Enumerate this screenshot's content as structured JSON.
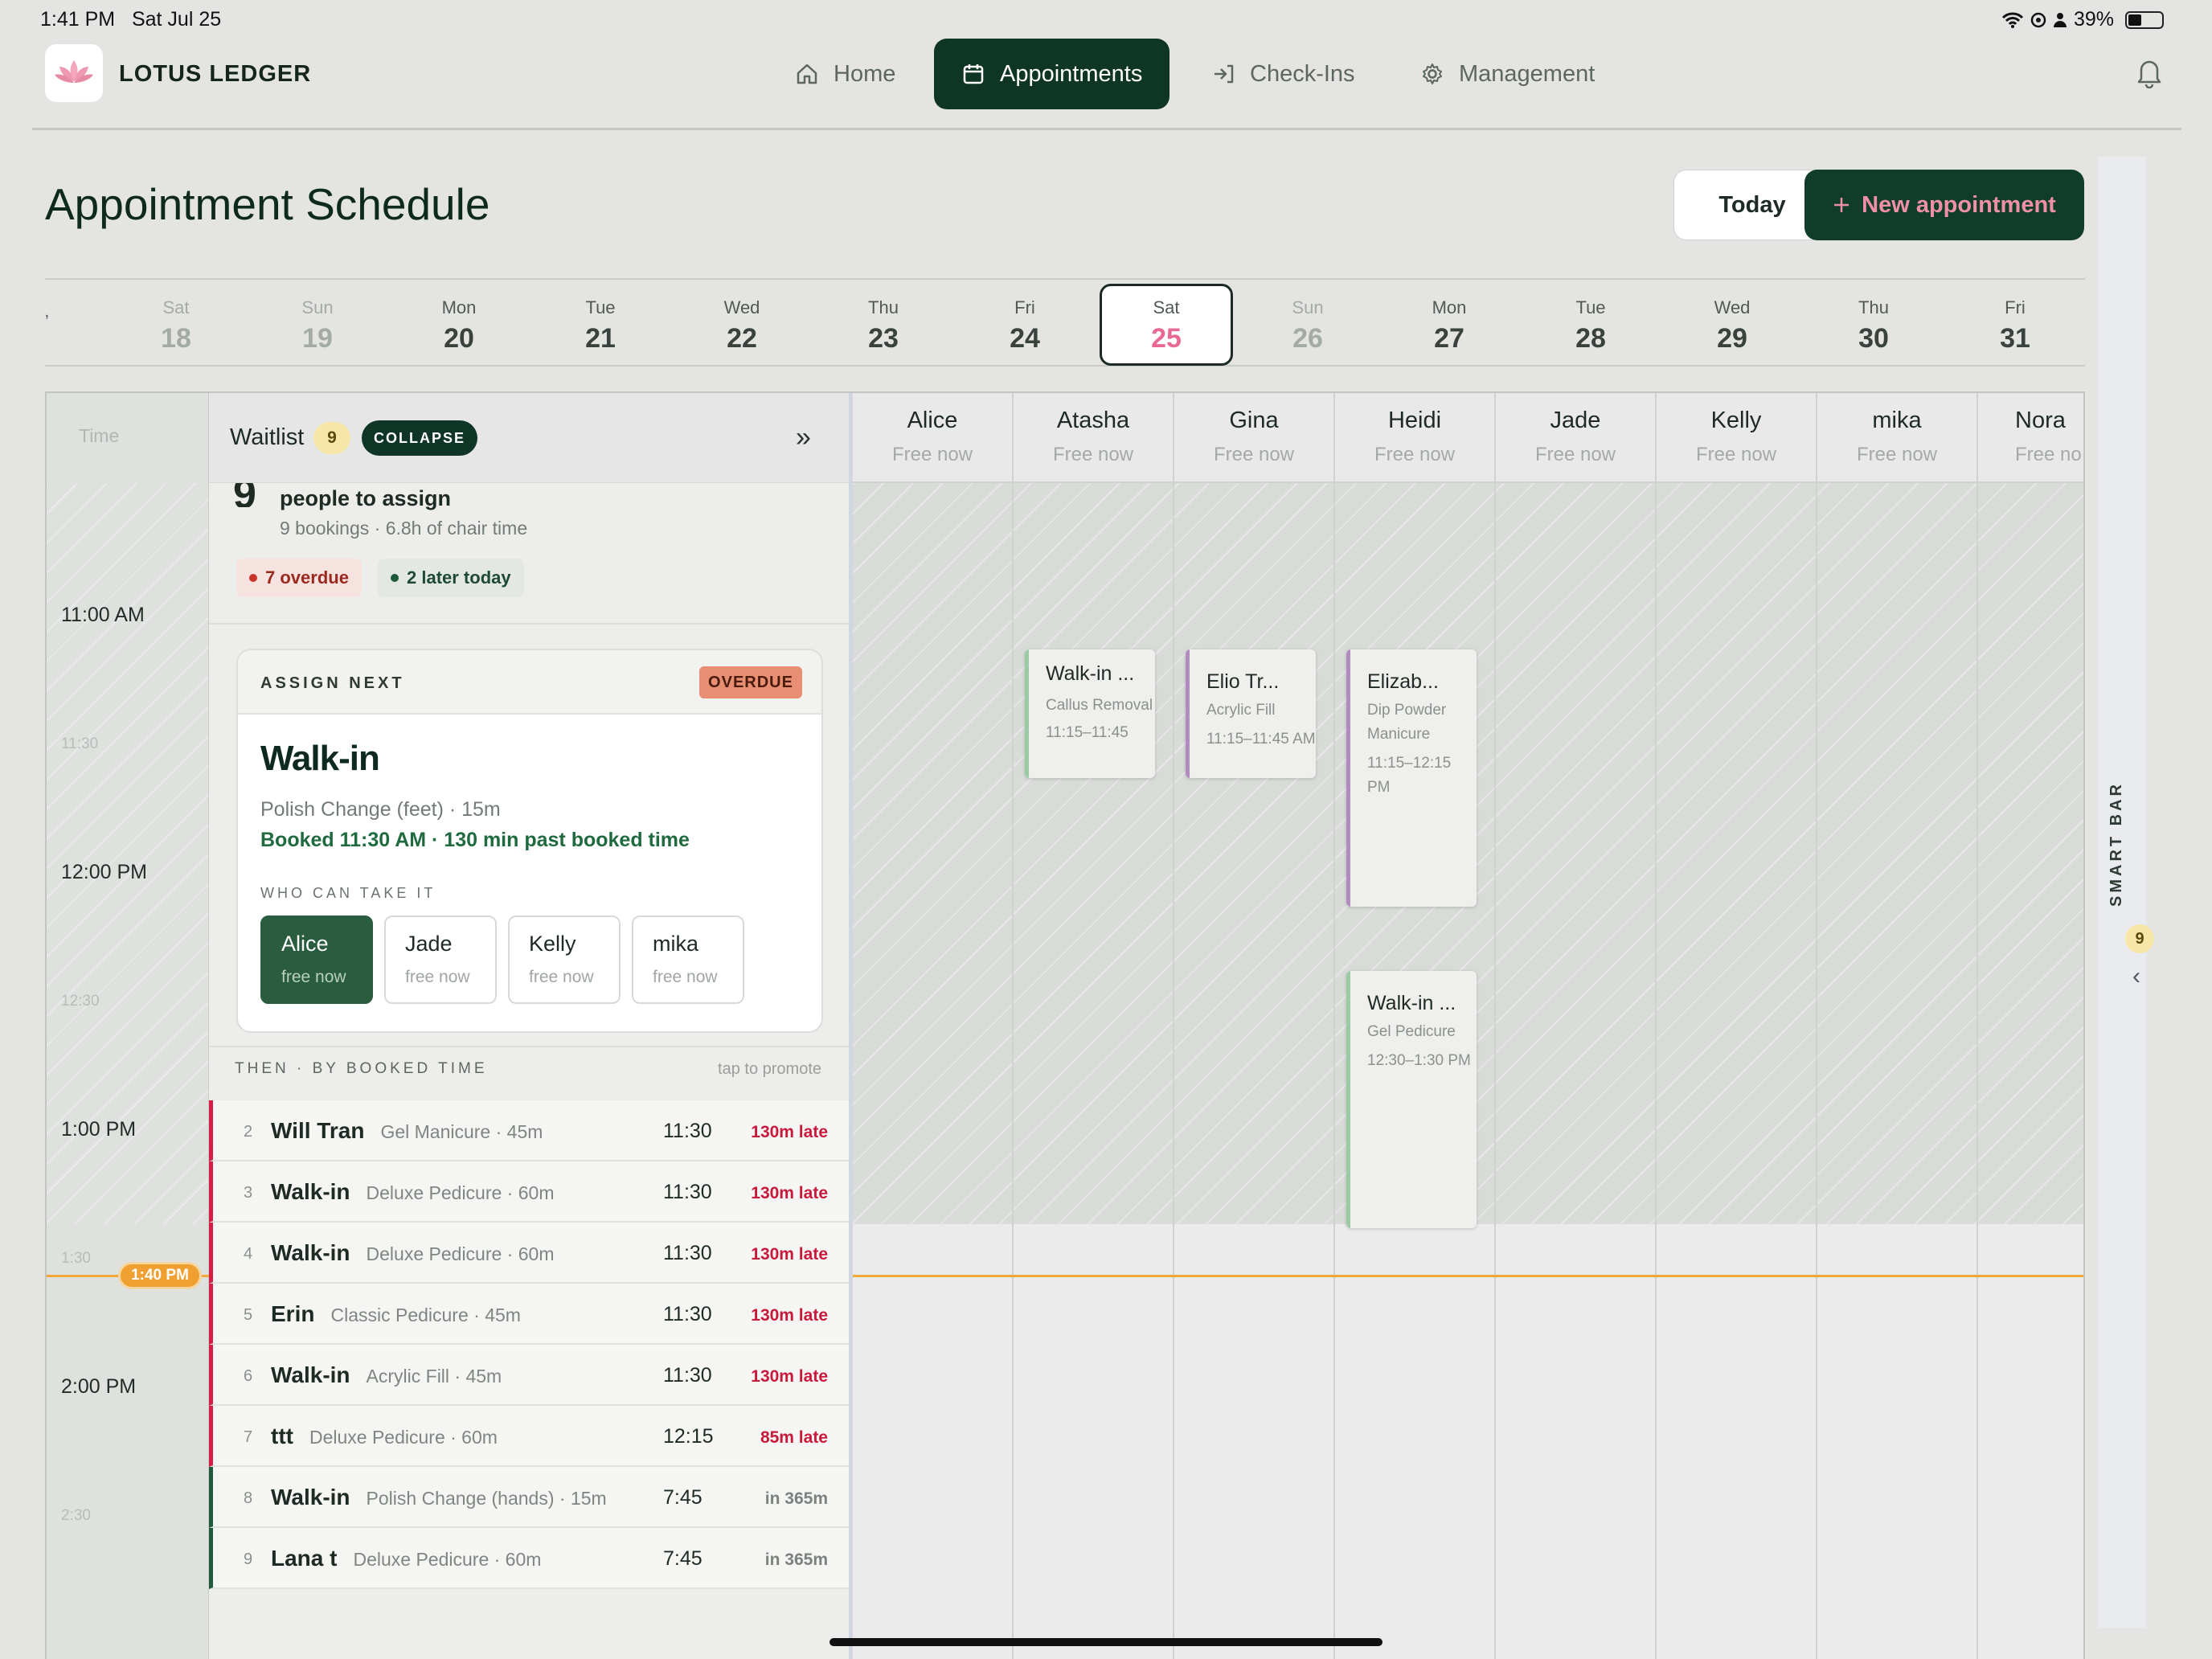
{
  "status": {
    "time": "1:41 PM",
    "date": "Sat Jul 25",
    "battery": "39%"
  },
  "app": {
    "name": "LOTUS LEDGER",
    "logo_icon": "lotus-icon"
  },
  "nav": [
    {
      "label": "Home",
      "icon": "home-icon",
      "active": false
    },
    {
      "label": "Appointments",
      "icon": "calendar-icon",
      "active": true
    },
    {
      "label": "Check-Ins",
      "icon": "check-in-icon",
      "active": false
    },
    {
      "label": "Management",
      "icon": "gear-icon",
      "active": false
    }
  ],
  "page": {
    "title": "Appointment Schedule",
    "today_label": "Today",
    "new_label": "New appointment"
  },
  "date_strip": {
    "days": [
      {
        "dow": "Sat",
        "date": "18"
      },
      {
        "dow": "Sun",
        "date": "19"
      },
      {
        "dow": "Mon",
        "date": "20"
      },
      {
        "dow": "Tue",
        "date": "21"
      },
      {
        "dow": "Wed",
        "date": "22"
      },
      {
        "dow": "Thu",
        "date": "23"
      },
      {
        "dow": "Fri",
        "date": "24"
      },
      {
        "dow": "Sat",
        "date": "25"
      },
      {
        "dow": "Sun",
        "date": "26"
      },
      {
        "dow": "Mon",
        "date": "27"
      },
      {
        "dow": "Tue",
        "date": "28"
      },
      {
        "dow": "Wed",
        "date": "29"
      },
      {
        "dow": "Thu",
        "date": "30"
      },
      {
        "dow": "Fri",
        "date": "31"
      }
    ],
    "selected": "25"
  },
  "timeline": {
    "time_header": "Time",
    "hours": [
      "11:00 AM",
      "12:00 PM",
      "1:00 PM",
      "2:00 PM"
    ],
    "half_hours": [
      "11:30",
      "12:30",
      "1:30",
      "2:30"
    ],
    "now": "1:40 PM"
  },
  "waitlist": {
    "title": "Waitlist",
    "count": "9",
    "collapse_label": "COLLAPSE",
    "summary_count": "9",
    "summary_title": "people to assign",
    "summary_sub": "9 bookings · 6.8h of chair time",
    "overdue_pill": "7 overdue",
    "later_pill": "2 later today",
    "assign": {
      "label": "ASSIGN NEXT",
      "badge": "OVERDUE",
      "name": "Walk-in",
      "service": "Polish Change (feet) · 15m",
      "booked": "Booked 11:30 AM · 130 min past booked time",
      "who_label": "WHO CAN TAKE IT",
      "staff": [
        {
          "name": "Alice",
          "status": "free now",
          "selected": true
        },
        {
          "name": "Jade",
          "status": "free now",
          "selected": false
        },
        {
          "name": "Kelly",
          "status": "free now",
          "selected": false
        },
        {
          "name": "mika",
          "status": "free now",
          "selected": false
        }
      ]
    },
    "queue_label": "THEN · BY BOOKED TIME",
    "queue_hint": "tap to promote",
    "queue": [
      {
        "idx": "2",
        "name": "Will Tran",
        "service": "Gel Manicure · 45m",
        "time": "11:30",
        "status": "130m late",
        "late": true
      },
      {
        "idx": "3",
        "name": "Walk-in",
        "service": "Deluxe Pedicure · 60m",
        "time": "11:30",
        "status": "130m late",
        "late": true
      },
      {
        "idx": "4",
        "name": "Walk-in",
        "service": "Deluxe Pedicure · 60m",
        "time": "11:30",
        "status": "130m late",
        "late": true
      },
      {
        "idx": "5",
        "name": "Erin",
        "service": "Classic Pedicure · 45m",
        "time": "11:30",
        "status": "130m late",
        "late": true
      },
      {
        "idx": "6",
        "name": "Walk-in",
        "service": "Acrylic Fill · 45m",
        "time": "11:30",
        "status": "130m late",
        "late": true
      },
      {
        "idx": "7",
        "name": "ttt",
        "service": "Deluxe Pedicure · 60m",
        "time": "12:15",
        "status": "85m late",
        "late": true
      },
      {
        "idx": "8",
        "name": "Walk-in",
        "service": "Polish Change (hands) · 15m",
        "time": "7:45",
        "status": "in 365m",
        "late": false
      },
      {
        "idx": "9",
        "name": "Lana t",
        "service": "Deluxe Pedicure · 60m",
        "time": "7:45",
        "status": "in 365m",
        "late": false
      }
    ]
  },
  "staff_columns": [
    {
      "name": "Alice",
      "status": "Free now"
    },
    {
      "name": "Atasha",
      "status": "Free now"
    },
    {
      "name": "Gina",
      "status": "Free now"
    },
    {
      "name": "Heidi",
      "status": "Free now"
    },
    {
      "name": "Jade",
      "status": "Free now"
    },
    {
      "name": "Kelly",
      "status": "Free now"
    },
    {
      "name": "mika",
      "status": "Free now"
    },
    {
      "name": "Nora",
      "status": "Free no"
    }
  ],
  "appointments": [
    {
      "staff": "Atasha",
      "title": "Walk-in ...",
      "service": "Callus Removal",
      "time": "11:15–11:45",
      "color": "#9cc9a6"
    },
    {
      "staff": "Gina",
      "title": "Elio Tr...",
      "service": "Acrylic Fill",
      "time": "11:15–11:45 AM",
      "color": "#b08cc0"
    },
    {
      "staff": "Heidi",
      "title": "Elizab...",
      "service": "Dip Powder Manicure",
      "time": "11:15–12:15 PM",
      "color": "#b08cc0"
    },
    {
      "staff": "Heidi",
      "title": "Walk-in ...",
      "service": "Gel Pedicure",
      "time": "12:30–1:30 PM",
      "color": "#9cc9a6"
    }
  ],
  "smart_bar": {
    "label": "SMART BAR",
    "count": "9"
  }
}
